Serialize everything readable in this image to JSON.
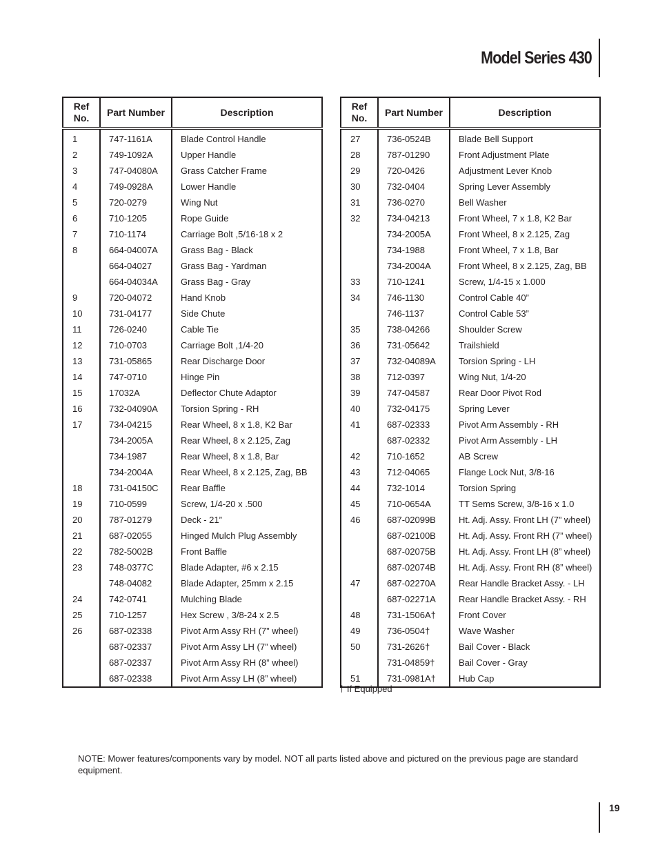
{
  "header": {
    "title": "Model Series 430"
  },
  "columns": {
    "ref": "Ref No.",
    "part_number": "Part Number",
    "description": "Description"
  },
  "left_table": {
    "rows": [
      {
        "ref": "1",
        "part": "747-1161A",
        "desc": "Blade Control Handle"
      },
      {
        "ref": "2",
        "part": "749-1092A",
        "desc": "Upper Handle"
      },
      {
        "ref": "3",
        "part": "747-04080A",
        "desc": "Grass Catcher Frame"
      },
      {
        "ref": "4",
        "part": "749-0928A",
        "desc": "Lower Handle"
      },
      {
        "ref": "5",
        "part": "720-0279",
        "desc": "Wing Nut"
      },
      {
        "ref": "6",
        "part": "710-1205",
        "desc": "Rope Guide"
      },
      {
        "ref": "7",
        "part": "710-1174",
        "desc": "Carriage Bolt ,5/16-18 x 2"
      },
      {
        "ref": "8",
        "part": "664-04007A",
        "desc": "Grass Bag - Black"
      },
      {
        "ref": "",
        "part": "664-04027",
        "desc": "Grass Bag - Yardman"
      },
      {
        "ref": "",
        "part": "664-04034A",
        "desc": "Grass Bag - Gray"
      },
      {
        "ref": "9",
        "part": "720-04072",
        "desc": "Hand Knob"
      },
      {
        "ref": "10",
        "part": "731-04177",
        "desc": "Side Chute"
      },
      {
        "ref": "11",
        "part": "726-0240",
        "desc": "Cable Tie"
      },
      {
        "ref": "12",
        "part": "710-0703",
        "desc": "Carriage Bolt ,1/4-20"
      },
      {
        "ref": "13",
        "part": "731-05865",
        "desc": "Rear Discharge Door"
      },
      {
        "ref": "14",
        "part": "747-0710",
        "desc": "Hinge Pin"
      },
      {
        "ref": "15",
        "part": "17032A",
        "desc": "Deflector Chute Adaptor"
      },
      {
        "ref": "16",
        "part": "732-04090A",
        "desc": "Torsion Spring - RH"
      },
      {
        "ref": "17",
        "part": "734-04215",
        "desc": "Rear Wheel, 8 x 1.8, K2 Bar"
      },
      {
        "ref": "",
        "part": "734-2005A",
        "desc": "Rear Wheel, 8 x 2.125, Zag"
      },
      {
        "ref": "",
        "part": "734-1987",
        "desc": "Rear Wheel, 8 x 1.8, Bar"
      },
      {
        "ref": "",
        "part": "734-2004A",
        "desc": "Rear Wheel, 8 x 2.125, Zag, BB"
      },
      {
        "ref": "18",
        "part": "731-04150C",
        "desc": "Rear Baffle"
      },
      {
        "ref": "19",
        "part": "710-0599",
        "desc": "Screw, 1/4-20 x .500"
      },
      {
        "ref": "20",
        "part": "787-01279",
        "desc": "Deck - 21”"
      },
      {
        "ref": "21",
        "part": "687-02055",
        "desc": "Hinged Mulch Plug Assembly"
      },
      {
        "ref": "22",
        "part": "782-5002B",
        "desc": "Front Baffle"
      },
      {
        "ref": "23",
        "part": "748-0377C",
        "desc": "Blade Adapter, #6 x 2.15"
      },
      {
        "ref": "",
        "part": "748-04082",
        "desc": "Blade Adapter, 25mm x 2.15"
      },
      {
        "ref": "24",
        "part": "742-0741",
        "desc": "Mulching Blade"
      },
      {
        "ref": "25",
        "part": "710-1257",
        "desc": "Hex Screw , 3/8-24 x 2.5"
      },
      {
        "ref": "26",
        "part": "687-02338",
        "desc": "Pivot Arm Assy RH (7” wheel)"
      },
      {
        "ref": "",
        "part": "687-02337",
        "desc": "Pivot Arm Assy LH (7” wheel)"
      },
      {
        "ref": "",
        "part": "687-02337",
        "desc": "Pivot Arm Assy RH (8” wheel)"
      },
      {
        "ref": "",
        "part": "687-02338",
        "desc": "Pivot Arm Assy LH (8” wheel)"
      }
    ]
  },
  "right_table": {
    "rows": [
      {
        "ref": "27",
        "part": "736-0524B",
        "desc": "Blade Bell Support"
      },
      {
        "ref": "28",
        "part": "787-01290",
        "desc": "Front Adjustment Plate"
      },
      {
        "ref": "29",
        "part": "720-0426",
        "desc": "Adjustment Lever Knob"
      },
      {
        "ref": "30",
        "part": "732-0404",
        "desc": "Spring Lever Assembly"
      },
      {
        "ref": "31",
        "part": "736-0270",
        "desc": "Bell Washer"
      },
      {
        "ref": "32",
        "part": "734-04213",
        "desc": "Front Wheel, 7 x 1.8, K2 Bar"
      },
      {
        "ref": "",
        "part": "734-2005A",
        "desc": "Front Wheel, 8 x 2.125, Zag"
      },
      {
        "ref": "",
        "part": "734-1988",
        "desc": "Front Wheel, 7 x 1.8, Bar"
      },
      {
        "ref": "",
        "part": "734-2004A",
        "desc": "Front Wheel, 8 x 2.125, Zag, BB"
      },
      {
        "ref": "33",
        "part": "710-1241",
        "desc": "Screw, 1/4-15 x 1.000"
      },
      {
        "ref": "34",
        "part": "746-1130",
        "desc": "Control Cable 40”"
      },
      {
        "ref": "",
        "part": "746-1137",
        "desc": "Control Cable 53”"
      },
      {
        "ref": "35",
        "part": "738-04266",
        "desc": "Shoulder Screw"
      },
      {
        "ref": "36",
        "part": "731-05642",
        "desc": "Trailshield"
      },
      {
        "ref": "37",
        "part": "732-04089A",
        "desc": "Torsion Spring - LH"
      },
      {
        "ref": "38",
        "part": "712-0397",
        "desc": "Wing Nut, 1/4-20"
      },
      {
        "ref": "39",
        "part": "747-04587",
        "desc": "Rear Door Pivot Rod"
      },
      {
        "ref": "40",
        "part": "732-04175",
        "desc": "Spring Lever"
      },
      {
        "ref": "41",
        "part": "687-02333",
        "desc": "Pivot Arm Assembly - RH"
      },
      {
        "ref": "",
        "part": "687-02332",
        "desc": "Pivot Arm Assembly - LH"
      },
      {
        "ref": "42",
        "part": "710-1652",
        "desc": "AB Screw"
      },
      {
        "ref": "43",
        "part": "712-04065",
        "desc": "Flange Lock Nut, 3/8-16"
      },
      {
        "ref": "44",
        "part": "732-1014",
        "desc": "Torsion Spring"
      },
      {
        "ref": "45",
        "part": "710-0654A",
        "desc": "TT Sems Screw, 3/8-16 x 1.0"
      },
      {
        "ref": "46",
        "part": "687-02099B",
        "desc": "Ht. Adj. Assy. Front LH (7” wheel)"
      },
      {
        "ref": "",
        "part": "687-02100B",
        "desc": "Ht. Adj. Assy. Front RH (7” wheel)"
      },
      {
        "ref": "",
        "part": "687-02075B",
        "desc": "Ht. Adj. Assy. Front LH (8” wheel)"
      },
      {
        "ref": "",
        "part": "687-02074B",
        "desc": "Ht. Adj. Assy. Front RH (8” wheel)"
      },
      {
        "ref": "47",
        "part": "687-02270A",
        "desc": "Rear Handle Bracket Assy. - LH"
      },
      {
        "ref": "",
        "part": "687-02271A",
        "desc": "Rear Handle Bracket Assy. - RH"
      },
      {
        "ref": "48",
        "part": "731-1506A†",
        "desc": "Front Cover"
      },
      {
        "ref": "49",
        "part": "736-0504†",
        "desc": "Wave Washer"
      },
      {
        "ref": "50",
        "part": "731-2626†",
        "desc": "Bail Cover - Black"
      },
      {
        "ref": "",
        "part": "731-04859†",
        "desc": "Bail Cover - Gray"
      },
      {
        "ref": "51",
        "part": "731-0981A†",
        "desc": "Hub Cap"
      }
    ]
  },
  "footnote": "† If Equipped",
  "note": "NOTE: Mower features/components vary by model. NOT all parts listed above and pictured on the previous page are standard equipment.",
  "page_number": "19"
}
